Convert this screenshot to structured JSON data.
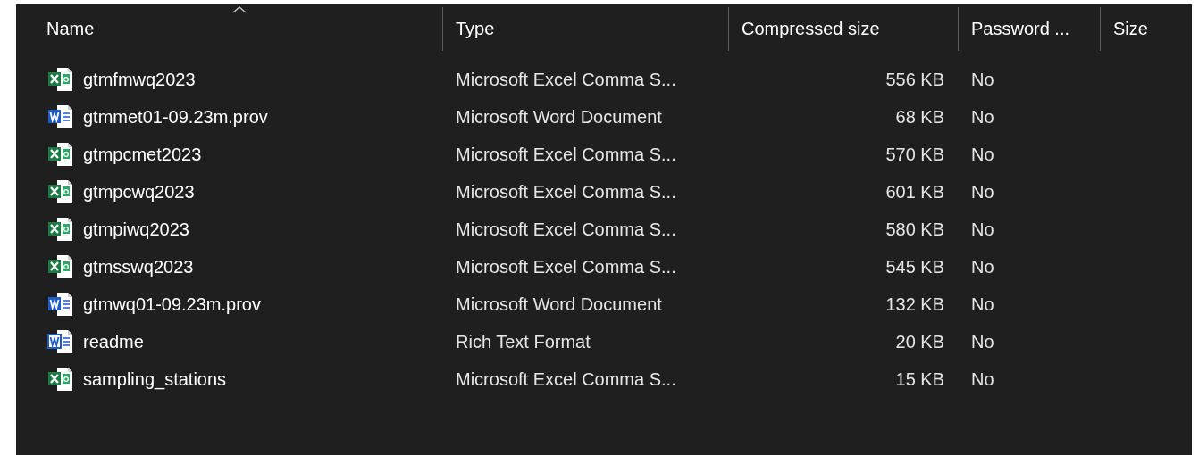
{
  "columns": [
    {
      "label": "Name",
      "sorted": true
    },
    {
      "label": "Type",
      "sorted": false
    },
    {
      "label": "Compressed size",
      "sorted": false
    },
    {
      "label": "Password ...",
      "sorted": false
    },
    {
      "label": "Size",
      "sorted": false
    }
  ],
  "rows": [
    {
      "kind": "excel",
      "name": "gtmfmwq2023",
      "type": "Microsoft Excel Comma S...",
      "compressed_size": "556 KB",
      "password": "No"
    },
    {
      "kind": "word",
      "name": "gtmmet01-09.23m.prov",
      "type": "Microsoft Word Document",
      "compressed_size": "68 KB",
      "password": "No"
    },
    {
      "kind": "excel",
      "name": "gtmpcmet2023",
      "type": "Microsoft Excel Comma S...",
      "compressed_size": "570 KB",
      "password": "No"
    },
    {
      "kind": "excel",
      "name": "gtmpcwq2023",
      "type": "Microsoft Excel Comma S...",
      "compressed_size": "601 KB",
      "password": "No"
    },
    {
      "kind": "excel",
      "name": "gtmpiwq2023",
      "type": "Microsoft Excel Comma S...",
      "compressed_size": "580 KB",
      "password": "No"
    },
    {
      "kind": "excel",
      "name": "gtmsswq2023",
      "type": "Microsoft Excel Comma S...",
      "compressed_size": "545 KB",
      "password": "No"
    },
    {
      "kind": "word",
      "name": "gtmwq01-09.23m.prov",
      "type": "Microsoft Word Document",
      "compressed_size": "132 KB",
      "password": "No"
    },
    {
      "kind": "rtf",
      "name": "readme",
      "type": "Rich Text Format",
      "compressed_size": "20 KB",
      "password": "No"
    },
    {
      "kind": "excel",
      "name": "sampling_stations",
      "type": "Microsoft Excel Comma S...",
      "compressed_size": "15 KB",
      "password": "No"
    }
  ]
}
